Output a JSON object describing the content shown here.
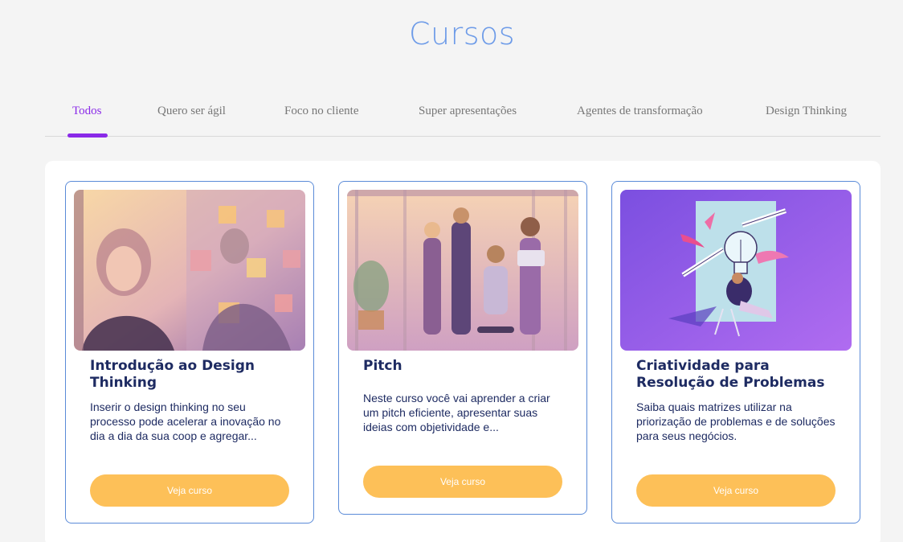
{
  "page": {
    "title": "Cursos"
  },
  "tabs": [
    {
      "label": "Todos",
      "active": true
    },
    {
      "label": "Quero ser ágil"
    },
    {
      "label": "Foco no cliente"
    },
    {
      "label": "Super apresentações"
    },
    {
      "label": "Agentes de transformação"
    },
    {
      "label": "Design Thinking"
    }
  ],
  "courses": [
    {
      "title": "Introdução ao Design Thinking",
      "description": "Inserir o design thinking no seu processo pode acelerar a inovação no dia a dia da sua coop e agregar...",
      "button_label": "Veja curso"
    },
    {
      "title": "Pitch",
      "description": "Neste curso você vai aprender a criar um pitch eficiente, apresentar suas ideias com objetividade e...",
      "button_label": "Veja curso"
    },
    {
      "title": "Criatividade para Resolução de Problemas",
      "description": "Saiba quais matrizes utilizar na priorização de problemas e de soluções para seus negócios.",
      "button_label": "Veja curso"
    }
  ],
  "colors": {
    "title": "#6d9be8",
    "active_tab": "#8a2ae8",
    "card_border": "#5b8bd8",
    "button": "#fdc058",
    "text_dark": "#1e2b62"
  }
}
